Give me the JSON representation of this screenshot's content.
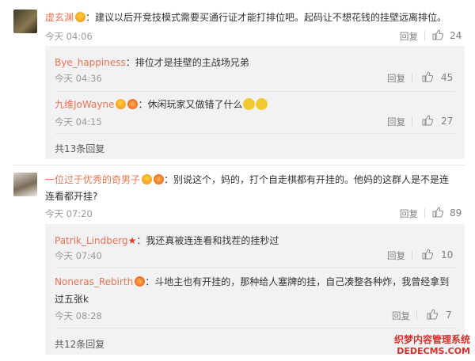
{
  "comments": [
    {
      "username": "虚玄渊",
      "text": "：建议以后开竞技模式需要买通行证才能打排位吧。起码让不想花钱的挂壁远离排位。",
      "time": "今天 04:06",
      "reply_label": "回复",
      "likes": "24",
      "replies": [
        {
          "username": "Bye_happiness",
          "text": "：排位才是挂壁的主战场兄弟",
          "time": "今天 04:36",
          "reply_label": "回复",
          "likes": "45"
        },
        {
          "username": "九维JoWayne",
          "text": "：休闲玩家又做错了什么",
          "time": "今天 04:15",
          "reply_label": "回复",
          "likes": "27"
        }
      ],
      "more": "共13条回复"
    },
    {
      "username": "一位过于优秀的奇男子",
      "text_line1": "：别说这个，妈的，打个自走棋都有开挂的。他妈的这群人是不是连",
      "text_line2": "连看都开挂?",
      "time": "今天 07:20",
      "reply_label": "回复",
      "likes": "89",
      "replies": [
        {
          "username": "Patrik_Lindberg",
          "text": "：我还真被连连看和找茬的挂秒过",
          "time": "今天 07:40",
          "reply_label": "回复",
          "likes": "10"
        },
        {
          "username": "Noneras_Rebirth",
          "text_line1": "：斗地主也有开挂的，那种给人塞牌的挂，自己凑整各种炸，我曾经拿到",
          "text_line2": "过五张k",
          "time": "今天 08:28",
          "reply_label": "回复",
          "likes": "7"
        }
      ],
      "more": "共12条回复"
    }
  ],
  "watermark": {
    "line1": "织梦内容管理系统",
    "line2": "DEDECMS.COM"
  },
  "colors": {
    "name": "#eb7350",
    "reply_bg": "#f2f2f5",
    "text": "#333333",
    "meta": "#999999"
  },
  "icons": [
    "like-icon",
    "vip-badge-icon",
    "emoji-icon",
    "star-icon"
  ]
}
